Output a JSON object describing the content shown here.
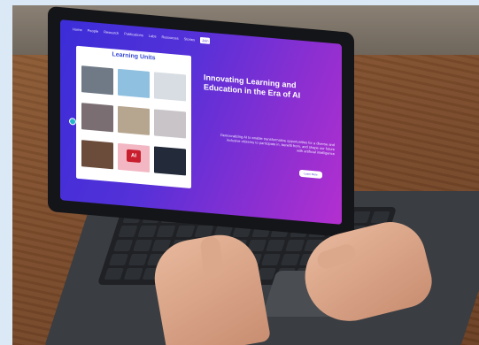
{
  "colors": {
    "background": "#dbe9f6",
    "screen_gradient_start": "#3b2dd8",
    "screen_gradient_end": "#b42fcf",
    "units_title": "#3a4cd6",
    "button_bg": "#ffffff"
  },
  "screen": {
    "nav": {
      "logo": "",
      "items": [
        "Home",
        "People",
        "Research",
        "Publications",
        "Labs",
        "Resources",
        "Stories",
        "Join"
      ]
    },
    "units": {
      "title": "Learning Units",
      "subtitle": "",
      "cards": [
        {
          "caption": "",
          "color": "#6f7a86"
        },
        {
          "caption": "",
          "color": "#8fc0e0"
        },
        {
          "caption": "",
          "color": "#d8dde3"
        },
        {
          "caption": "",
          "color": "#7a6e72"
        },
        {
          "caption": "",
          "color": "#b7a68f"
        },
        {
          "caption": "",
          "color": "#c9c4c8"
        },
        {
          "caption": "",
          "color": "#6b4b3a"
        },
        {
          "caption": "",
          "color": "#f2b7c2"
        },
        {
          "caption": "",
          "color": "#232a39"
        }
      ],
      "card_ai_label": "AI"
    },
    "hero": {
      "title": "Innovating Learning and Education in the Era of AI",
      "body": "Democratizing AI to enable transformative opportunities for a diverse and inclusive citizenry to participate in, benefit from, and shape our future with artificial intelligence",
      "button_label": "Learn More"
    }
  },
  "icons": {
    "side_indicator": "circle-dot-icon"
  }
}
